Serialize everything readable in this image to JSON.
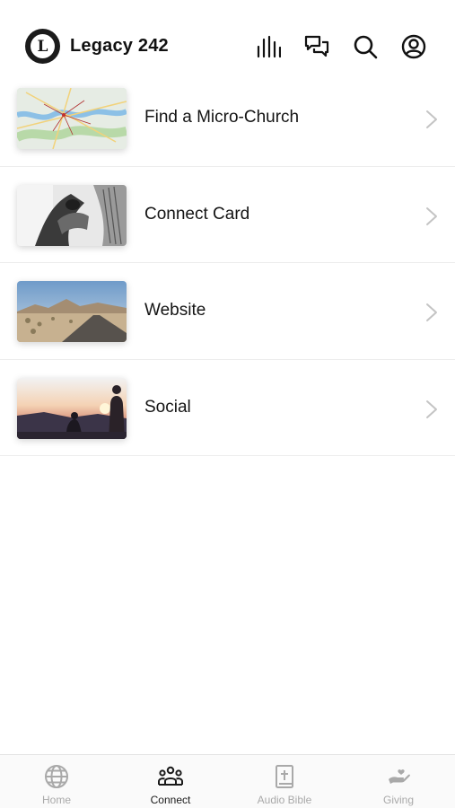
{
  "header": {
    "logo_letter": "L",
    "title": "Legacy 242",
    "icons": [
      "audio-bars-icon",
      "chat-bubbles-icon",
      "search-icon",
      "profile-icon"
    ]
  },
  "list": {
    "items": [
      {
        "label": "Find a Micro-Church",
        "thumbnail": "map-thumbnail"
      },
      {
        "label": "Connect Card",
        "thumbnail": "hands-bw-thumbnail"
      },
      {
        "label": "Website",
        "thumbnail": "desert-road-thumbnail"
      },
      {
        "label": "Social",
        "thumbnail": "sunset-people-thumbnail"
      }
    ]
  },
  "tabbar": {
    "tabs": [
      {
        "label": "Home",
        "icon": "globe-icon",
        "active": false
      },
      {
        "label": "Connect",
        "icon": "people-icon",
        "active": true
      },
      {
        "label": "Audio Bible",
        "icon": "bible-icon",
        "active": false
      },
      {
        "label": "Giving",
        "icon": "giving-hand-icon",
        "active": false
      }
    ]
  },
  "colors": {
    "text": "#141414",
    "inactive_tab": "#a9a9a9",
    "divider": "#ececec",
    "logo_bg": "#1b1b1b"
  }
}
